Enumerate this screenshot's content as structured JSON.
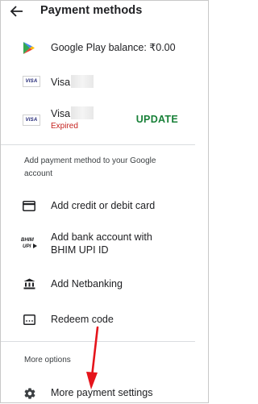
{
  "header": {
    "title": "Payment methods",
    "back_icon": "arrow-back-icon"
  },
  "methods": [
    {
      "icon": "google-play-icon",
      "label": "Google Play balance: ₹0.00"
    },
    {
      "icon": "visa-card-icon",
      "brand": "VISA",
      "label": "Visa"
    },
    {
      "icon": "visa-card-icon",
      "brand": "VISA",
      "label": "Visa",
      "status": "Expired",
      "action": "UPDATE"
    }
  ],
  "add_section": {
    "heading": "Add payment method to your Google account",
    "items": [
      {
        "icon": "credit-card-icon",
        "label": "Add credit or debit card"
      },
      {
        "icon": "bhim-upi-icon",
        "icon_text": "BHIM UPI",
        "label": "Add bank account with BHIM UPI ID"
      },
      {
        "icon": "bank-icon",
        "label": "Add Netbanking"
      },
      {
        "icon": "redeem-code-icon",
        "label": "Redeem code"
      }
    ]
  },
  "more_section": {
    "heading": "More options",
    "items": [
      {
        "icon": "gear-icon",
        "label": "More payment settings"
      }
    ]
  },
  "colors": {
    "expired": "#c5221f",
    "update": "#188038",
    "annotation_arrow": "#e5141b"
  }
}
